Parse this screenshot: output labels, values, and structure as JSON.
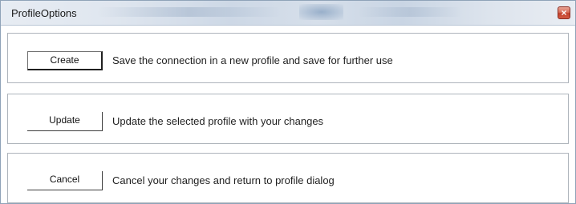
{
  "window": {
    "title": "ProfileOptions",
    "close_symbol": "×",
    "close_icon": "close-icon"
  },
  "options": [
    {
      "button_label": "Create",
      "description": "Save the connection in a new profile and save for further use"
    },
    {
      "button_label": "Update",
      "description": "Update the selected profile with your changes"
    },
    {
      "button_label": "Cancel",
      "description": "Cancel your changes and return to profile dialog"
    }
  ],
  "colors": {
    "title_bar": "#dfe6ef",
    "close_button": "#c2412c",
    "panel_border": "#aeb4bb"
  }
}
